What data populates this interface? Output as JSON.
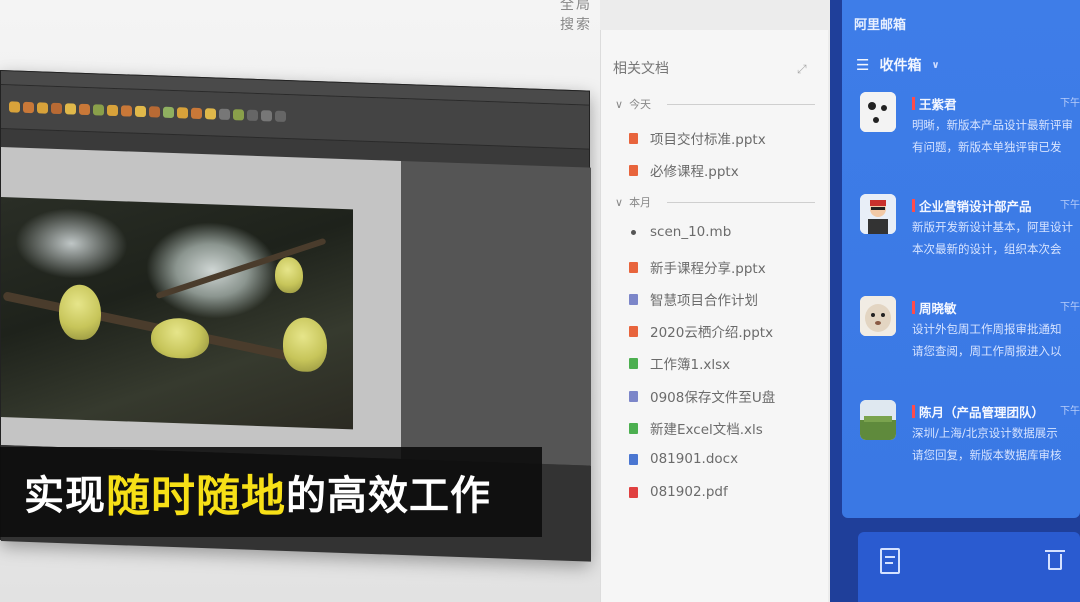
{
  "header": {
    "partial_title": "全局搜索"
  },
  "caption": {
    "prefix": "实现",
    "highlight": "随时随地",
    "suffix": "的高效工作",
    "highlight_color": "#f7e017"
  },
  "docs": {
    "title": "相关文档",
    "groups": [
      {
        "label": "今天",
        "items": [
          {
            "name": "项目交付标准.pptx",
            "icon": "pptx-file-icon",
            "color": "#e8643c"
          },
          {
            "name": "必修课程.pptx",
            "icon": "pptx-file-icon",
            "color": "#e8643c"
          }
        ]
      },
      {
        "label": "本月",
        "items": [
          {
            "name": "scen_10.mb",
            "icon": "maya-file-icon",
            "color": "#555555"
          },
          {
            "name": "新手课程分享.pptx",
            "icon": "pptx-file-icon",
            "color": "#e8643c"
          },
          {
            "name": "智慧项目合作计划",
            "icon": "doc-file-icon",
            "color": "#7c86c9"
          },
          {
            "name": "2020云栖介绍.pptx",
            "icon": "pptx-file-icon",
            "color": "#e8643c"
          },
          {
            "name": "工作簿1.xlsx",
            "icon": "xlsx-file-icon",
            "color": "#4caf50"
          },
          {
            "name": "0908保存文件至U盘",
            "icon": "doc-file-icon",
            "color": "#7c86c9"
          },
          {
            "name": "新建Excel文档.xls",
            "icon": "xlsx-file-icon",
            "color": "#4caf50"
          },
          {
            "name": "081901.docx",
            "icon": "docx-file-icon",
            "color": "#4a76d1"
          },
          {
            "name": "081902.pdf",
            "icon": "pdf-file-icon",
            "color": "#e04040"
          }
        ]
      }
    ]
  },
  "mail": {
    "app_title": "阿里邮箱",
    "folder": "收件箱",
    "items": [
      {
        "sender": "王紫君",
        "lines": [
          "明晰，新版本产品设计最新评审",
          "有问题，新版本单独评审已发"
        ],
        "time": "下午"
      },
      {
        "sender": "企业营销设计部产品",
        "lines": [
          "新版开发新设计基本，阿里设计",
          "本次最新的设计，组织本次会"
        ],
        "time": "下午"
      },
      {
        "sender": "周晓敏",
        "lines": [
          "设计外包周工作周报审批通知",
          "请您查阅，周工作周报进入以"
        ],
        "time": "下午"
      },
      {
        "sender": "陈月（产品管理团队）",
        "lines": [
          "深圳/上海/北京设计数据展示",
          "请您回复，新版本数据库审核"
        ],
        "time": "下午"
      }
    ]
  }
}
